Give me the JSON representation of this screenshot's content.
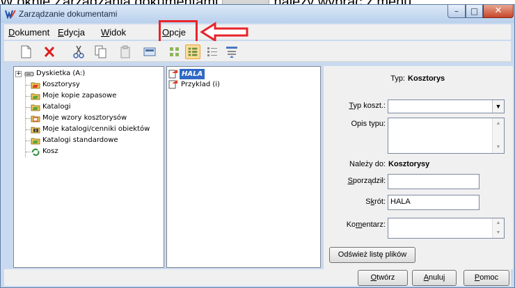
{
  "caption": {
    "text_before": "W oknie Zarządzania dokumentami",
    "text_after": "należy wybrać z menu"
  },
  "window": {
    "title": "Zarządzanie dokumentami",
    "controls": {
      "minimize": "–",
      "maximize": "□",
      "close": "✕"
    }
  },
  "menu": {
    "items": [
      {
        "first": "D",
        "rest": "okument"
      },
      {
        "first": "E",
        "rest": "dycja"
      },
      {
        "first": "W",
        "rest": "idok"
      },
      {
        "first": "O",
        "rest": "pcje"
      }
    ]
  },
  "toolbar": {
    "icons": [
      "new-document-icon",
      "delete-icon",
      "cut-icon",
      "copy-icon",
      "paste-icon",
      "screen-icon",
      "large-icons-view-icon",
      "small-icons-view-icon",
      "list-view-icon",
      "details-view-icon"
    ]
  },
  "tree": {
    "items": [
      {
        "label": "Dyskietka (A:)",
        "icon": "floppy-drive-icon"
      },
      {
        "label": "Kosztorysy",
        "icon": "folder-cost-estimates-icon"
      },
      {
        "label": "Moje kopie zapasowe",
        "icon": "folder-backup-icon"
      },
      {
        "label": "Katalogi",
        "icon": "folder-catalogs-icon"
      },
      {
        "label": "Moje wzory kosztorysów",
        "icon": "folder-templates-icon"
      },
      {
        "label": "Moje katalogi/cenniki obiektów",
        "icon": "folder-price-lists-icon"
      },
      {
        "label": "Katalogi standardowe",
        "icon": "folder-standard-catalogs-icon"
      },
      {
        "label": "Kosz",
        "icon": "recycle-bin-icon"
      }
    ]
  },
  "files": {
    "items": [
      {
        "label": "HALA",
        "selected": true
      },
      {
        "label": "Przyklad (i)",
        "selected": false
      }
    ]
  },
  "details": {
    "typ_label": "Typ:",
    "typ_value": "Kosztorys",
    "typ_koszt": {
      "first": "T",
      "rest": "yp koszt.:",
      "value": ""
    },
    "opis_typu_label": "Opis typu:",
    "nalezy_do_label": "Należy do:",
    "nalezy_do_value": "Kosztorysy",
    "sporzadzil": {
      "first": "S",
      "rest": "porządził:",
      "value": ""
    },
    "skrot": {
      "pre": "S",
      "ul": "k",
      "rest": "rót:",
      "value": "HALA"
    },
    "komentarz": {
      "pre": "Ko",
      "ul": "m",
      "rest": "entarz:",
      "value": ""
    },
    "refresh_button": "Odśwież listę plików"
  },
  "buttons": {
    "open": {
      "first": "O",
      "rest": "twórz"
    },
    "cancel": {
      "first": "A",
      "rest": "nuluj"
    },
    "help": {
      "first": "P",
      "rest": "omoc"
    }
  },
  "colors": {
    "annotation_red": "#e8232a",
    "selection_blue": "#3169c6",
    "window_frame": "#c9daf0"
  }
}
